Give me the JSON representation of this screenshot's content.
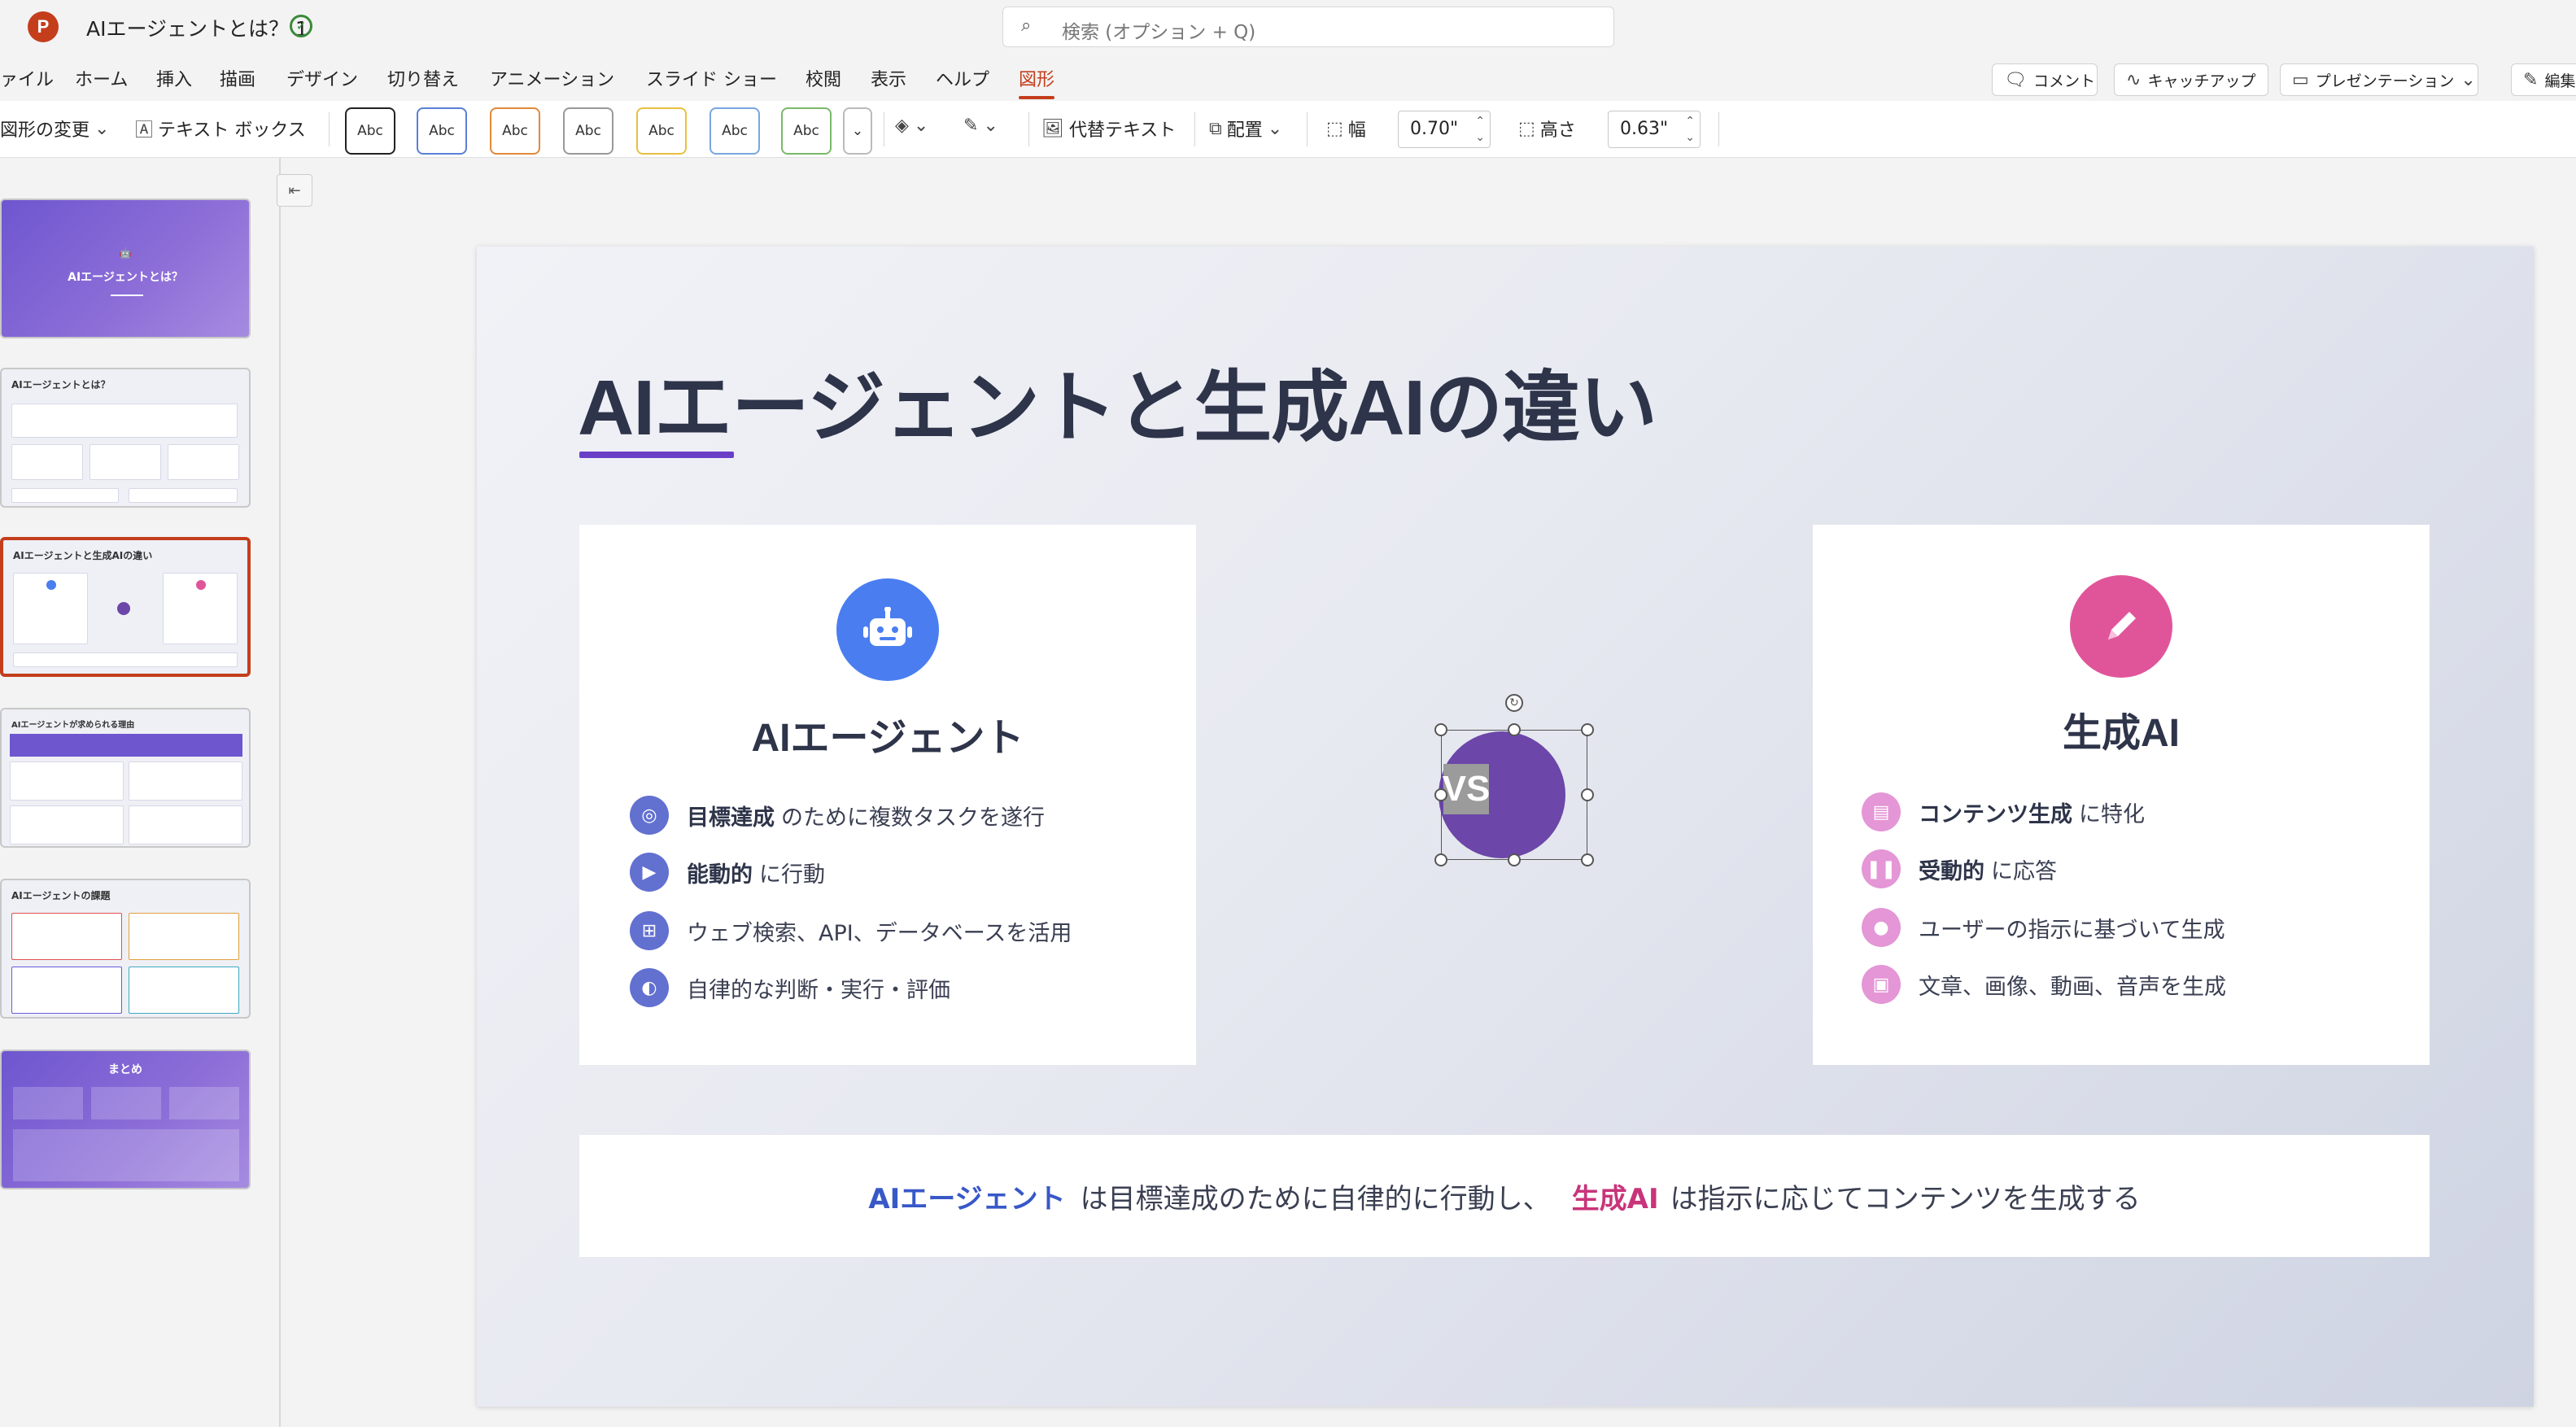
{
  "window": {
    "app_icon": "P",
    "doc_title": "AIエージェントとは？ 1",
    "sync_icon": "cloud-check-icon"
  },
  "search": {
    "placeholder": "検索 (オプション + Q)"
  },
  "ribbon_tabs": [
    "ァイル",
    "ホーム",
    "挿入",
    "描画",
    "デザイン",
    "切り替え",
    "アニメーション",
    "スライド ショー",
    "校閲",
    "表示",
    "ヘルプ",
    "図形"
  ],
  "ribbon_active_tab": "図形",
  "ribbon_right": {
    "comment": "コメント",
    "catchup": "キャッチアップ",
    "present": "プレゼンテーション",
    "edit": "編集"
  },
  "toolbar": {
    "change_shape": "図形の変更",
    "text_box": "テキスト ボックス",
    "style_presets": [
      "Abc",
      "Abc",
      "Abc",
      "Abc",
      "Abc",
      "Abc",
      "Abc"
    ],
    "alt_text": "代替テキスト",
    "arrange": "配置",
    "width_label": "幅",
    "width_value": "0.70\"",
    "height_label": "高さ",
    "height_value": "0.63\""
  },
  "thumbnails": [
    {
      "title": "AIエージェントとは？",
      "selected": false
    },
    {
      "title": "AIエージェントとは？",
      "selected": false
    },
    {
      "title": "AIエージェントと生成AIの違い",
      "selected": true
    },
    {
      "title": "AIエージェントが求められる理由",
      "selected": false
    },
    {
      "title": "AIエージェントの課題",
      "selected": false
    },
    {
      "title": "まとめ",
      "selected": false
    }
  ],
  "slide": {
    "title": "AIエージェントと生成AIの違い",
    "left_card": {
      "heading": "AIエージェント",
      "icon": "robot-icon",
      "bullets": [
        {
          "strong": "目標達成",
          "text": "のために複数タスクを遂行",
          "icon": "target-icon"
        },
        {
          "strong": "能動的",
          "text": "に行動",
          "icon": "play-icon"
        },
        {
          "strong": "",
          "text": "ウェブ検索、API、データベースを活用",
          "icon": "network-icon"
        },
        {
          "strong": "",
          "text": "自律的な判断・実行・評価",
          "icon": "brain-icon"
        }
      ]
    },
    "vs_label": "VS",
    "right_card": {
      "heading": "生成AI",
      "icon": "pen-icon",
      "bullets": [
        {
          "strong": "コンテンツ生成",
          "text": "に特化",
          "icon": "document-icon"
        },
        {
          "strong": "受動的",
          "text": "に応答",
          "icon": "pause-icon"
        },
        {
          "strong": "",
          "text": "ユーザーの指示に基づいて生成",
          "icon": "chat-icon"
        },
        {
          "strong": "",
          "text": "文章、画像、動画、音声を生成",
          "icon": "image-icon"
        }
      ]
    },
    "summary": {
      "part1": "AIエージェント",
      "part2": "は目標達成のために自律的に行動し、",
      "part3": "生成AI",
      "part4": "は指示に応じてコンテンツを生成する"
    }
  },
  "colors": {
    "accent": "#c43e1c",
    "blue": "#4a7ef0",
    "pink": "#e0559a",
    "purple": "#6c46a8",
    "title_underline": "#6a3fc8"
  }
}
